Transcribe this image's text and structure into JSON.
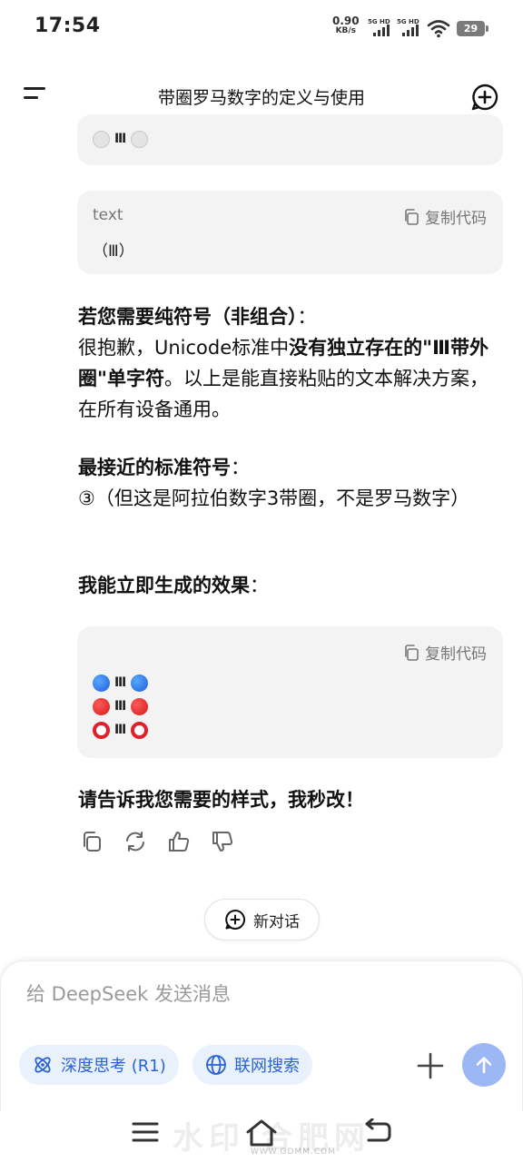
{
  "status_bar": {
    "time": "17:54",
    "net_speed": "0.90",
    "net_unit": "KB/s",
    "sim1": "5G HD",
    "sim2": "5G HD",
    "battery": "29"
  },
  "header": {
    "title": "带圈罗马数字的定义与使用"
  },
  "blocks": {
    "top_code": {
      "content": "Ⅲ"
    },
    "code2": {
      "lang": "text",
      "copy_label": "复制代码",
      "content": "（Ⅲ）"
    },
    "para1": {
      "heading": "若您需要纯符号（非组合）",
      "colon": "：",
      "text_a": "很抱歉，Unicode标准中",
      "text_bold": "没有独立存在的\"Ⅲ带外圈\"单字符",
      "text_b": "。以上是能直接粘贴的文本解决方案，在所有设备通用。"
    },
    "para2": {
      "heading": "最接近的标准符号",
      "colon": "：",
      "text": "③（但这是阿拉伯数字3带圈，不是罗马数字）"
    },
    "para3": {
      "heading": "我能立即生成的效果",
      "colon": "："
    },
    "code3": {
      "copy_label": "复制代码",
      "roman": "Ⅲ"
    },
    "closing": "请告诉我您需要的样式，我秒改！"
  },
  "new_dialog_label": "新对话",
  "composer": {
    "placeholder": "给 DeepSeek 发送消息",
    "deep_think_label": "深度思考 (R1)",
    "web_search_label": "联网搜索"
  },
  "watermark": {
    "text": "水印 合肥网",
    "url": "WWW.GDMM.COM"
  },
  "colors": {
    "accent": "#2a62d8",
    "send_button": "#9bb8f5",
    "code_bg": "#f3f3f3"
  }
}
